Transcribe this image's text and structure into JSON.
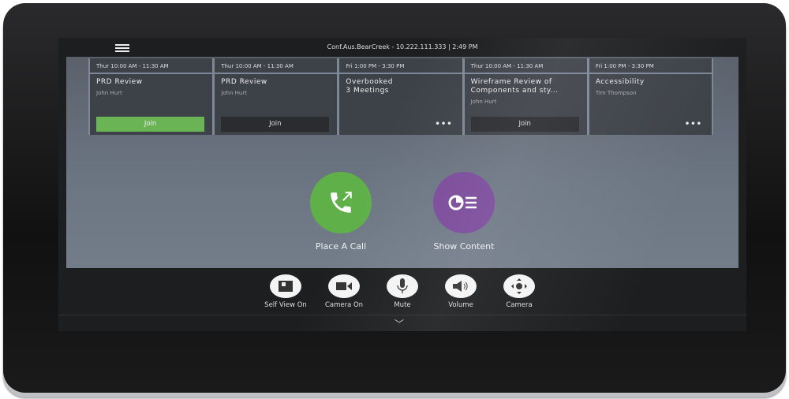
{
  "header": {
    "room": "Conf.Aus.BearCreek - 10.222.111.333  |  2:49 PM"
  },
  "meetings": [
    {
      "time": "Thur 10:00 AM - 11:30 AM",
      "title": "PRD Review",
      "organizer": "John Hurt",
      "action": "Join",
      "style": "green"
    },
    {
      "time": "Thur 10:00 AM - 11:30 AM",
      "title": "PRD Review",
      "organizer": "John Hurt",
      "action": "Join",
      "style": "dark"
    },
    {
      "time": "Fri 1:00 PM - 3:30 PM",
      "title": "Overbooked\n3 Meetings",
      "organizer": "",
      "action": "•••"
    },
    {
      "time": "Thur 10:00 AM - 11:30 AM",
      "title": "Wireframe Review of Components and sty...",
      "organizer": "John Hurt",
      "action": "Join",
      "style": "dark"
    },
    {
      "time": "Fri 1:00 PM - 3:30 PM",
      "title": "Accessibility",
      "organizer": "Tim Thompson",
      "action": "•••"
    }
  ],
  "actions": {
    "call": "Place A Call",
    "content": "Show Content"
  },
  "colors": {
    "call": "#5fb049",
    "content": "#7a4a9a",
    "join": "#6ab456"
  },
  "controls": [
    {
      "label": "Self View On",
      "icon": "self-view-icon"
    },
    {
      "label": "Camera On",
      "icon": "camera-icon"
    },
    {
      "label": "Mute",
      "icon": "microphone-icon"
    },
    {
      "label": "Volume",
      "icon": "speaker-icon"
    },
    {
      "label": "Camera",
      "icon": "camera-control-icon"
    }
  ]
}
